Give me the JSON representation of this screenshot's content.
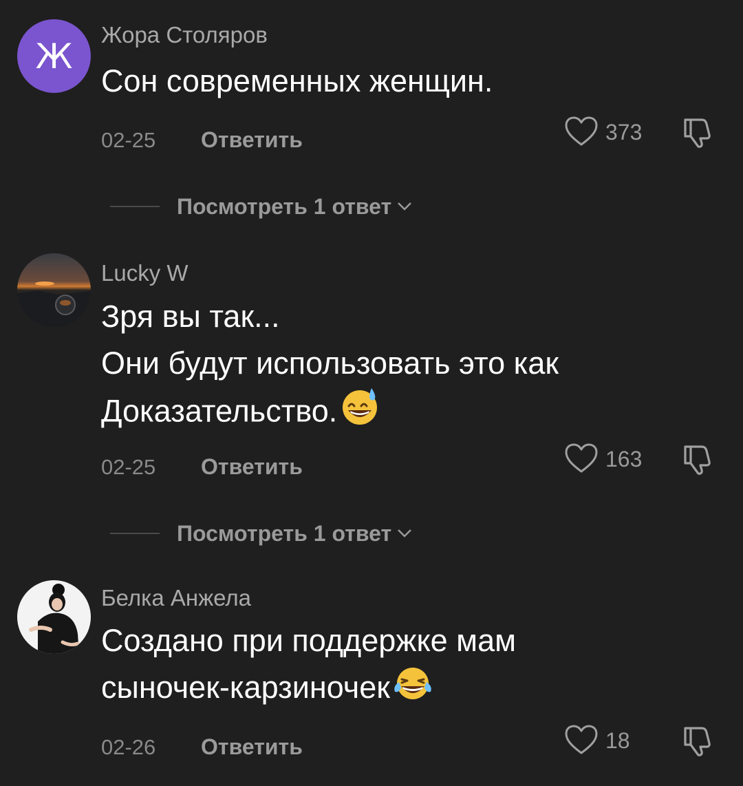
{
  "comments": [
    {
      "avatar_letter": "Ж",
      "username": "Жора Столяров",
      "text_lines": [
        "Сон современных женщин."
      ],
      "date": "02-25",
      "reply_label": "Ответить",
      "likes": "373",
      "view_replies_label": "Посмотреть 1 ответ"
    },
    {
      "username": "Lucky W",
      "text_lines": [
        "Зря вы так...",
        "Они будут использовать это как",
        "Доказательство."
      ],
      "emoji_name": "grinning-sweat-emoji",
      "date": "02-25",
      "reply_label": "Ответить",
      "likes": "163",
      "view_replies_label": "Посмотреть 1 ответ"
    },
    {
      "username": "Белка Анжела",
      "text_lines": [
        "Создано при поддержке мам",
        "сыночек-карзиночек"
      ],
      "emoji_name": "tears-of-joy-emoji",
      "date": "02-26",
      "reply_label": "Ответить",
      "likes": "18"
    }
  ],
  "colors": {
    "background": "#1f1f1f",
    "avatar_purple": "#7b55cf",
    "username": "#a9a9a9",
    "secondary_text": "#9a9a9a"
  }
}
